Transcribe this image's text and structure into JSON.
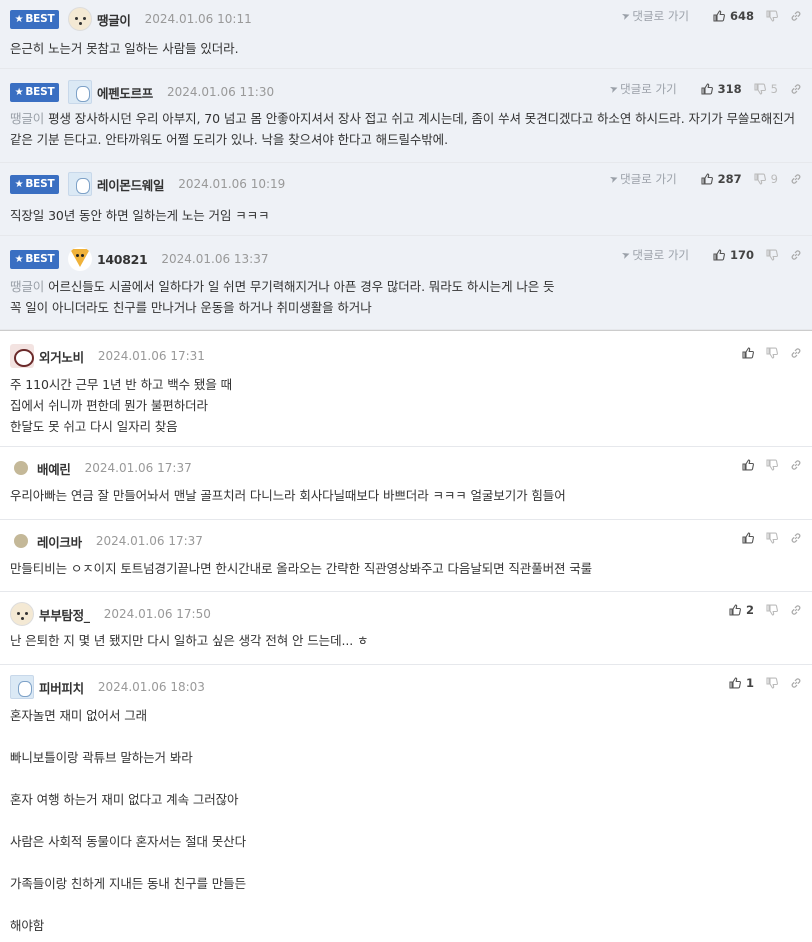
{
  "ui": {
    "best_label": "BEST",
    "goto_label": "댓글로 가기"
  },
  "best_comments": [
    {
      "avatar": "dog",
      "nick": "땡글이",
      "date": "2024.01.06 10:11",
      "up": "648",
      "down": "",
      "mention": "",
      "text": "은근히 노는거 못참고 일하는 사람들 있더라."
    },
    {
      "avatar": "bear",
      "nick": "에펜도르프",
      "date": "2024.01.06 11:30",
      "up": "318",
      "down": "5",
      "mention": "땡글이",
      "text": " 평생 장사하시던 우리 아부지, 70 넘고 몸 안좋아지셔서 장사 접고 쉬고 계시는데, 좀이 쑤셔 못견디겠다고 하소연 하시드라. 자기가 무쓸모해진거 같은 기분 든다고. 안타까워도 어쩔 도리가 있나. 낙을 찾으셔야 한다고 해드릴수밖에."
    },
    {
      "avatar": "bear",
      "nick": "레이몬드웨일",
      "date": "2024.01.06 10:19",
      "up": "287",
      "down": "9",
      "mention": "",
      "text": "직장일 30년 동안 하면 일하는게 노는 거임 ㅋㅋㅋ"
    },
    {
      "avatar": "fox",
      "nick": "140821",
      "date": "2024.01.06 13:37",
      "up": "170",
      "down": "",
      "mention": "땡글이",
      "text": " 어르신들도 시골에서 일하다가 일 쉬면 무기력해지거나 아픈 경우 많더라. 뭐라도 하시는게 나은 듯\n꼭 일이 아니더라도 친구를 만나거나 운동을 하거나 취미생활을 하거나"
    }
  ],
  "comments": [
    {
      "avatar": "panda",
      "nick": "외거노비",
      "date": "2024.01.06 17:31",
      "up": "",
      "text": "주 110시간 근무 1년 반 하고 백수 됐을 때\n집에서 쉬니까 편한데 뭔가 불편하더라\n한달도 못 쉬고 다시 일자리 찾음"
    },
    {
      "avatar": "dot",
      "nick": "배예린",
      "date": "2024.01.06 17:37",
      "up": "",
      "text": "우리아빠는 연금 잘 만들어놔서 맨날 골프치러 다니느라 회사다닐때보다 바쁘더라 ㅋㅋㅋ 얼굴보기가 힘들어"
    },
    {
      "avatar": "dot",
      "nick": "레이크바",
      "date": "2024.01.06 17:37",
      "up": "",
      "text": "만들티비는 ㅇㅈ이지 토트넘경기끝나면 한시간내로 올라오는 간략한 직관영상봐주고 다음날되면 직관풀버젼 국룰"
    },
    {
      "avatar": "dog",
      "nick": "부부탐정_",
      "date": "2024.01.06 17:50",
      "up": "2",
      "text": "난 은퇴한 지 몇 년 됐지만 다시 일하고 싶은 생각 전혀 안 드는데... ㅎ"
    },
    {
      "avatar": "bear",
      "nick": "피버피치",
      "date": "2024.01.06 18:03",
      "up": "1",
      "text": "혼자놀면 재미 없어서 그래\n\n빠니보틀이랑 곽튜브 말하는거 봐라\n\n혼자 여행 하는거 재미 없다고 계속 그러잖아\n\n사람은 사회적 동물이다 혼자서는 절대 못산다\n\n가족들이랑 친하게 지내든 동내 친구를 만들든\n\n해야함"
    }
  ]
}
